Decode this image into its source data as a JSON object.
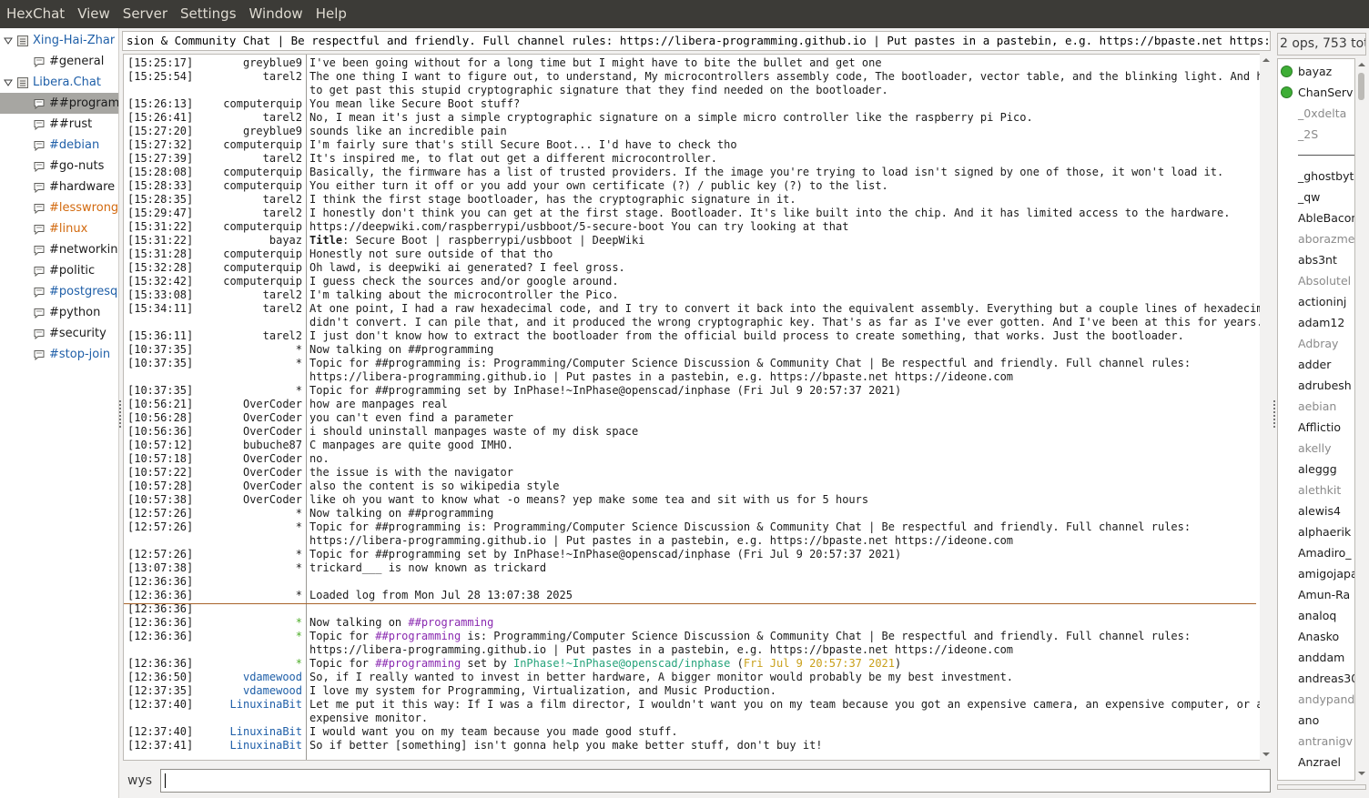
{
  "menubar": [
    "HexChat",
    "View",
    "Server",
    "Settings",
    "Window",
    "Help"
  ],
  "tree": [
    {
      "label": "Xing-Hai-Zhar",
      "type": "network",
      "expanded": true,
      "color": "#1f5fa8"
    },
    {
      "label": "#general",
      "type": "channel",
      "color": "#1b1b1b"
    },
    {
      "label": "Libera.Chat",
      "type": "network",
      "expanded": true,
      "color": "#1f5fa8"
    },
    {
      "label": "##programm",
      "type": "channel",
      "color": "#1b1b1b",
      "selected": true
    },
    {
      "label": "##rust",
      "type": "channel",
      "color": "#1b1b1b"
    },
    {
      "label": "#debian",
      "type": "channel",
      "color": "#1f5fa8"
    },
    {
      "label": "#go-nuts",
      "type": "channel",
      "color": "#1b1b1b"
    },
    {
      "label": "#hardware",
      "type": "channel",
      "color": "#1b1b1b"
    },
    {
      "label": "#lesswrong",
      "type": "channel",
      "color": "#d2690e"
    },
    {
      "label": "#linux",
      "type": "channel",
      "color": "#d2690e"
    },
    {
      "label": "#networkin",
      "type": "channel",
      "color": "#1b1b1b"
    },
    {
      "label": "#politic",
      "type": "channel",
      "color": "#1b1b1b"
    },
    {
      "label": "#postgresq",
      "type": "channel",
      "color": "#1f5fa8"
    },
    {
      "label": "#python",
      "type": "channel",
      "color": "#1b1b1b"
    },
    {
      "label": "#security",
      "type": "channel",
      "color": "#1b1b1b"
    },
    {
      "label": "#stop-join",
      "type": "channel",
      "color": "#1f5fa8"
    }
  ],
  "topic": "sion & Community Chat | Be respectful and friendly. Full channel rules: https://libera-programming.github.io | Put pastes in a pastebin, e.g. https://bpaste.net https://ideone.com",
  "chat": [
    {
      "ts": "[15:25:17]",
      "nick": "greyblue9",
      "msg": "I've been going without for a long time but I might have to bite the bullet and get one"
    },
    {
      "ts": "[15:25:54]",
      "nick": "tarel2",
      "msg": "The one thing I want to figure out, to understand, My microcontrollers assembly code, The bootloader, vector table, and the blinking light. And how"
    },
    {
      "ts": "",
      "nick": "",
      "msg": "to get past this stupid cryptographic signature that they find needed on the bootloader."
    },
    {
      "ts": "[15:26:13]",
      "nick": "computerquip",
      "msg": "You mean like Secure Boot stuff?"
    },
    {
      "ts": "[15:26:41]",
      "nick": "tarel2",
      "msg": "No, I mean it's just a simple cryptographic signature on a simple micro controller like the raspberry pi Pico."
    },
    {
      "ts": "[15:27:20]",
      "nick": "greyblue9",
      "msg": "sounds like an incredible pain"
    },
    {
      "ts": "[15:27:32]",
      "nick": "computerquip",
      "msg": "I'm fairly sure that's still Secure Boot... I'd have to check tho"
    },
    {
      "ts": "[15:27:39]",
      "nick": "tarel2",
      "msg": "It's inspired me, to flat out get a different microcontroller."
    },
    {
      "ts": "[15:28:08]",
      "nick": "computerquip",
      "msg": "Basically, the firmware has a list of trusted providers. If the image you're trying to load isn't signed by one of those, it won't load it."
    },
    {
      "ts": "[15:28:33]",
      "nick": "computerquip",
      "msg": "You either turn it off or you add your own certificate (?) / public key (?) to the list."
    },
    {
      "ts": "[15:28:35]",
      "nick": "tarel2",
      "msg": "I think the first stage bootloader, has the cryptographic signature in it."
    },
    {
      "ts": "[15:29:47]",
      "nick": "tarel2",
      "msg": "I honestly don't think you can get at the first stage. Bootloader. It's like built into the chip. And it has limited access to the hardware."
    },
    {
      "ts": "[15:31:22]",
      "nick": "computerquip",
      "msg": "https://deepwiki.com/raspberrypi/usbboot/5-secure-boot You can try looking at that"
    },
    {
      "ts": "[15:31:22]",
      "nick": "bayaz",
      "msg_bold": "Title",
      "msg": ": Secure Boot | raspberrypi/usbboot | DeepWiki"
    },
    {
      "ts": "[15:31:28]",
      "nick": "computerquip",
      "msg": "Honestly not sure outside of that tho"
    },
    {
      "ts": "[15:32:28]",
      "nick": "computerquip",
      "msg": "Oh lawd, is deepwiki ai generated? I feel gross."
    },
    {
      "ts": "[15:32:42]",
      "nick": "computerquip",
      "msg": "I guess check the sources and/or google around."
    },
    {
      "ts": "[15:33:08]",
      "nick": "tarel2",
      "msg": "I'm talking about the microcontroller the Pico."
    },
    {
      "ts": "[15:34:11]",
      "nick": "tarel2",
      "msg": "At one point, I had a raw hexadecimal code, and I try to convert it back into the equivalent assembly. Everything but a couple lines of hexadecimal"
    },
    {
      "ts": "",
      "nick": "",
      "msg": "didn't convert. I can pile that, and it produced the wrong cryptographic key. That's as far as I've ever gotten. And I've been at this for years."
    },
    {
      "ts": "[15:36:11]",
      "nick": "tarel2",
      "msg": "I just don't know how to extract the bootloader from the official build process to create something, that works. Just the bootloader."
    },
    {
      "ts": "[10:37:35]",
      "nick": "*",
      "msg": "Now talking on ##programming"
    },
    {
      "ts": "[10:37:35]",
      "nick": "*",
      "msg": "Topic for ##programming is: Programming/Computer Science Discussion & Community Chat | Be respectful and friendly. Full channel rules:"
    },
    {
      "ts": "",
      "nick": "",
      "msg": "https://libera-programming.github.io | Put pastes in a pastebin, e.g. https://bpaste.net https://ideone.com"
    },
    {
      "ts": "[10:37:35]",
      "nick": "*",
      "msg": "Topic for ##programming set by InPhase!~InPhase@openscad/inphase (Fri Jul  9 20:57:37 2021)"
    },
    {
      "ts": "[10:56:21]",
      "nick": "OverCoder",
      "msg": "how are manpages real"
    },
    {
      "ts": "[10:56:28]",
      "nick": "OverCoder",
      "msg": "you can't even find a parameter"
    },
    {
      "ts": "[10:56:36]",
      "nick": "OverCoder",
      "msg": "i should uninstall manpages waste of my disk space"
    },
    {
      "ts": "[10:57:12]",
      "nick": "bubuche87",
      "msg": "C manpages are quite good IMHO."
    },
    {
      "ts": "[10:57:18]",
      "nick": "OverCoder",
      "msg": "no."
    },
    {
      "ts": "[10:57:22]",
      "nick": "OverCoder",
      "msg": "the issue is with the navigator"
    },
    {
      "ts": "[10:57:28]",
      "nick": "OverCoder",
      "msg": "also the content is so wikipedia style"
    },
    {
      "ts": "[10:57:38]",
      "nick": "OverCoder",
      "msg": "like oh you want to know what -o means? yep make some tea and sit with us for 5 hours"
    },
    {
      "ts": "[12:57:26]",
      "nick": "*",
      "msg": "Now talking on ##programming"
    },
    {
      "ts": "[12:57:26]",
      "nick": "*",
      "msg": "Topic for ##programming is: Programming/Computer Science Discussion & Community Chat | Be respectful and friendly. Full channel rules:"
    },
    {
      "ts": "",
      "nick": "",
      "msg": "https://libera-programming.github.io | Put pastes in a pastebin, e.g. https://bpaste.net https://ideone.com"
    },
    {
      "ts": "[12:57:26]",
      "nick": "*",
      "msg": "Topic for ##programming set by InPhase!~InPhase@openscad/inphase (Fri Jul  9 20:57:37 2021)"
    },
    {
      "ts": "[13:07:38]",
      "nick": "*",
      "msg": "trickard___ is now known as trickard"
    },
    {
      "ts": "[12:36:36]",
      "nick": "",
      "msg": ""
    },
    {
      "ts": "[12:36:36]",
      "nick": "*",
      "msg": "Loaded log from Mon Jul 28 13:07:38 2025"
    },
    {
      "ts": "[12:36:36]",
      "nick": "",
      "msg": ""
    },
    {
      "ts": "[12:36:36]",
      "nick": "*",
      "nick_color": "#4fae2a",
      "msg": "Now talking on ",
      "msg_colored": "##programming",
      "colored_color": "#8a2ab0"
    },
    {
      "ts": "[12:36:36]",
      "nick": "*",
      "nick_color": "#4fae2a",
      "msg": "Topic for ",
      "msg_colored": "##programming",
      "colored_color": "#8a2ab0",
      "msg_tail": " is: Programming/Computer Science Discussion & Community Chat | Be respectful and friendly. Full channel rules:"
    },
    {
      "ts": "",
      "nick": "",
      "msg": "https://libera-programming.github.io | Put pastes in a pastebin, e.g. https://bpaste.net https://ideone.com"
    },
    {
      "ts": "[12:36:36]",
      "nick": "*",
      "nick_color": "#4fae2a",
      "msg": "Topic for ",
      "msg_colored": "##programming",
      "colored_color": "#8a2ab0",
      "msg_tail": " set by ",
      "msg_colored2": "InPhase!~InPhase@openscad/inphase",
      "colored2_color": "#24a37a",
      "msg_tail2": " (",
      "msg_colored3": "Fri Jul  9 20:57:37 2021",
      "colored3_color": "#c9a01a",
      "msg_tail3": ")"
    },
    {
      "ts": "[12:36:50]",
      "nick": "vdamewood",
      "nick_color": "#1f5fa8",
      "msg": "So, if I really wanted to invest in better hardware, A bigger monitor would probably be my best investment."
    },
    {
      "ts": "[12:37:35]",
      "nick": "vdamewood",
      "nick_color": "#1f5fa8",
      "msg": "I love my system for Programming, Virtualization, and Music Production."
    },
    {
      "ts": "[12:37:40]",
      "nick": "LinuxinaBit",
      "nick_color": "#1f5fa8",
      "msg": "Let me put it this way: If I was a film director, I wouldn't want you on my team because you got an expensive camera, an expensive computer, or an"
    },
    {
      "ts": "",
      "nick": "",
      "msg": "expensive monitor."
    },
    {
      "ts": "[12:37:40]",
      "nick": "LinuxinaBit",
      "nick_color": "#1f5fa8",
      "msg": "I would want you on my team because you made good stuff."
    },
    {
      "ts": "[12:37:41]",
      "nick": "LinuxinaBit",
      "nick_color": "#1f5fa8",
      "msg": "So if better [something] isn't gonna help you make better stuff, don't buy it!"
    }
  ],
  "input": {
    "nick": "wys",
    "value": ""
  },
  "usercount": "2 ops, 753 tota",
  "users": [
    {
      "name": "bayaz",
      "op": true
    },
    {
      "name": "ChanServ",
      "op": true
    },
    {
      "name": "_0xdelta",
      "away": true
    },
    {
      "name": "_2S",
      "away": true
    },
    {
      "separator": true
    },
    {
      "name": "_ghostbyt"
    },
    {
      "name": "_qw"
    },
    {
      "name": "AbleBacon"
    },
    {
      "name": "aborazmeh",
      "away": true
    },
    {
      "name": "abs3nt"
    },
    {
      "name": "Absolutel",
      "away": true
    },
    {
      "name": "actioninj"
    },
    {
      "name": "adam12"
    },
    {
      "name": "Adbray",
      "away": true
    },
    {
      "name": "adder"
    },
    {
      "name": "adrubesh"
    },
    {
      "name": "aebian",
      "away": true
    },
    {
      "name": "Afflictio"
    },
    {
      "name": "akelly",
      "away": true
    },
    {
      "name": "aleggg"
    },
    {
      "name": "alethkit",
      "away": true
    },
    {
      "name": "alewis4"
    },
    {
      "name": "alphaerik"
    },
    {
      "name": "Amadiro_"
    },
    {
      "name": "amigojapa"
    },
    {
      "name": "Amun-Ra"
    },
    {
      "name": "analoq"
    },
    {
      "name": "Anasko"
    },
    {
      "name": "anddam"
    },
    {
      "name": "andreas30"
    },
    {
      "name": "andypandy",
      "away": true
    },
    {
      "name": "ano"
    },
    {
      "name": "antranigv",
      "away": true
    },
    {
      "name": "Anzrael"
    }
  ]
}
